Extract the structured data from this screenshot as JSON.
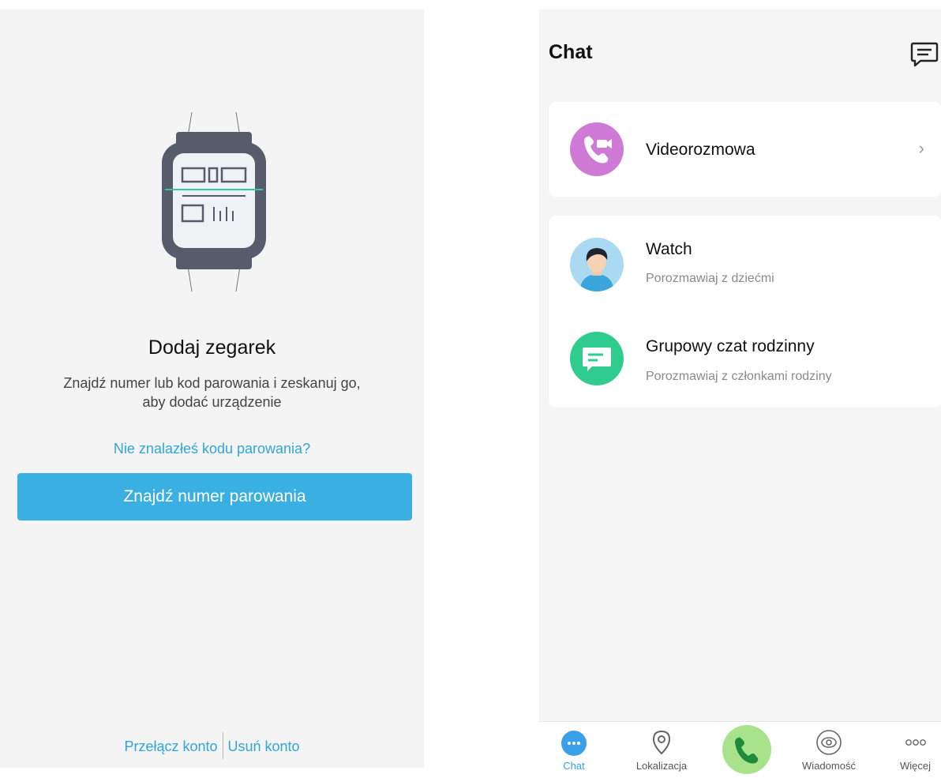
{
  "colors": {
    "accent": "#3ab0e2",
    "link": "#2fa6d9",
    "tab_active": "#3aa0e8",
    "video_icon": "#d07ad8",
    "group_icon": "#2fcc8e",
    "call_button": "#a8e28a"
  },
  "add_watch": {
    "title": "Dodaj zegarek",
    "description_line1": "Znajdź numer lub kod parowania i zeskanuj go,",
    "description_line2": "aby dodać urządzenie",
    "no_code_link": "Nie znalazłeś kodu parowania?",
    "find_button": "Znajdź numer parowania",
    "switch_account": "Przełącz konto",
    "delete_account": "Usuń konto",
    "illustration_icon": "watch-qr-scan-icon"
  },
  "chat": {
    "title": "Chat",
    "compose_icon": "message-square-icon",
    "video_call": {
      "label": "Videorozmowa",
      "icon": "video-call-icon"
    },
    "contacts": [
      {
        "name": "Watch",
        "subtitle": "Porozmawiaj z dziećmi",
        "icon": "person-avatar"
      },
      {
        "name": "Grupowy czat rodzinny",
        "subtitle": "Porozmawiaj z członkami rodziny",
        "icon": "chat-bubble-icon"
      }
    ],
    "tabs": [
      {
        "label": "Chat",
        "icon": "chat-dots-icon",
        "active": true
      },
      {
        "label": "Lokalizacja",
        "icon": "location-pin-icon",
        "active": false
      },
      {
        "label": "",
        "icon": "phone-icon",
        "active": false
      },
      {
        "label": "Wiadomość",
        "icon": "eye-icon",
        "active": false
      },
      {
        "label": "Więcej",
        "icon": "more-dots-icon",
        "active": false
      }
    ]
  }
}
